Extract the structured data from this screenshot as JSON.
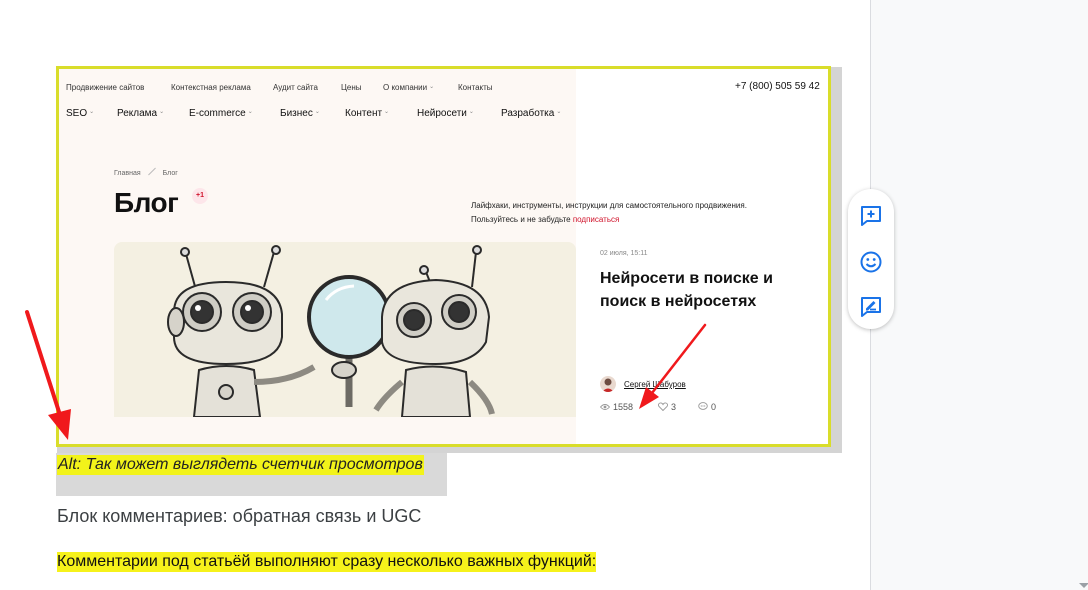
{
  "embedded_screenshot": {
    "top_nav": [
      "Продвижение сайтов",
      "Контекстная реклама",
      "Аудит сайта",
      "Цены",
      "О компании",
      "Контакты"
    ],
    "phone": "+7 (800) 505 59 42",
    "main_nav": [
      "SEO",
      "Реклама",
      "E-commerce",
      "Бизнес",
      "Контент",
      "Нейросети",
      "Разработка"
    ],
    "breadcrumbs": [
      "Главная",
      "Блог"
    ],
    "page_title": "Блог",
    "badge": "+1",
    "tagline_line1": "Лайфхаки, инструменты, инструкции для самостоятельного продвижения.",
    "tagline_line2": "Пользуйтесь и не забудьте ",
    "subscribe_link": "подписаться",
    "post": {
      "date": "02 июля, 15:11",
      "title": "Нейросети в поиске и поиск в нейросетях",
      "author": "Сергей Шабуров",
      "views": "1558",
      "likes": "3",
      "comments": "0"
    }
  },
  "side_toolbar": [
    "add-comment-icon",
    "emoji-reaction-icon",
    "suggest-edit-icon"
  ],
  "document": {
    "caption": "Alt: Так может выглядеть счетчик просмотров",
    "heading": "Блок комментариев: обратная связь и UGC",
    "paragraph": "Комментарии под статьёй выполняют сразу несколько важных функций:"
  },
  "colors": {
    "highlight_yellow": "#f2f31a",
    "frame_yellow": "#d9dd2a",
    "accent_red": "#d0122a",
    "annotation_arrow": "#f0191c",
    "toolbar_blue": "#1a73e8"
  }
}
